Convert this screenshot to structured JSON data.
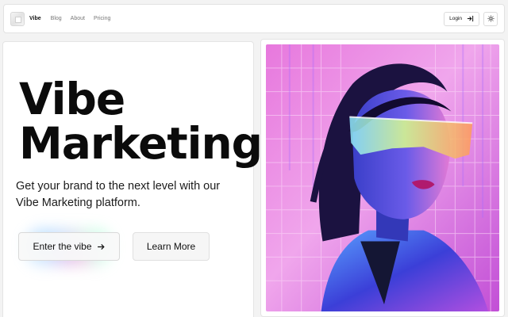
{
  "nav": {
    "brand": "Vibe",
    "links": [
      "Blog",
      "About",
      "Pricing"
    ],
    "login_label": "Login",
    "login_icon": "login-arrow-icon",
    "theme_icon": "sun-icon"
  },
  "hero": {
    "title_line1": "Vibe",
    "title_line2": "Marketing",
    "subtitle": "Get your brand to the next level with our Vibe Marketing platform.",
    "primary_cta": "Enter the vibe",
    "primary_cta_icon": "arrow-right-icon",
    "secondary_cta": "Learn More"
  },
  "image": {
    "subject": "woman-with-futuristic-visor-neon-grid"
  },
  "colors": {
    "accent_pink": "#e25bd6",
    "accent_blue": "#4a63f0",
    "text": "#111111",
    "border": "#e2e2e2"
  }
}
